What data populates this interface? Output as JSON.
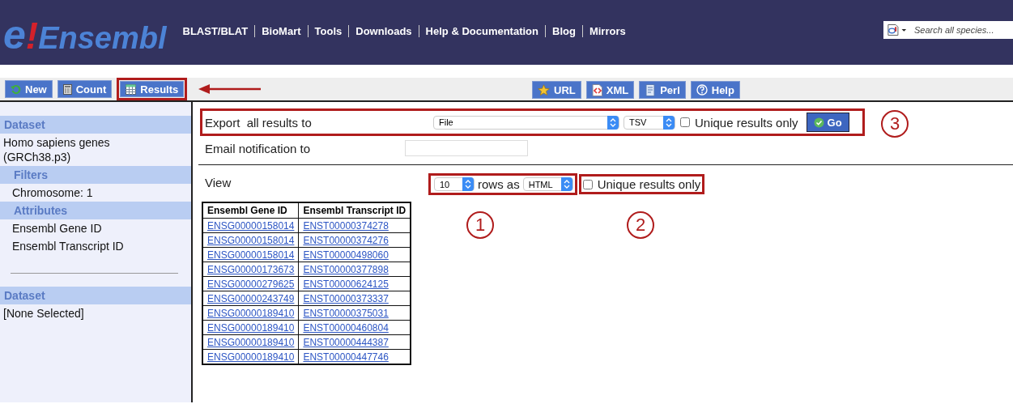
{
  "header": {
    "logo": [
      "e",
      "!",
      "Ensembl"
    ],
    "nav": [
      "BLAST/BLAT",
      "BioMart",
      "Tools",
      "Downloads",
      "Help & Documentation",
      "Blog",
      "Mirrors"
    ],
    "search": {
      "placeholder": "Search all species..."
    }
  },
  "toolbar": {
    "left": [
      {
        "label": "New",
        "highlighted": false
      },
      {
        "label": "Count",
        "highlighted": false
      },
      {
        "label": "Results",
        "highlighted": true
      }
    ],
    "right": [
      {
        "label": "URL"
      },
      {
        "label": "XML"
      },
      {
        "label": "Perl"
      },
      {
        "label": "Help"
      }
    ]
  },
  "sidebar": [
    {
      "kind": "header",
      "text": "Dataset"
    },
    {
      "kind": "text",
      "text": "Homo sapiens genes (GRCh38.p3)"
    },
    {
      "kind": "subheader",
      "text": "Filters"
    },
    {
      "kind": "item",
      "text": "Chromosome: 1"
    },
    {
      "kind": "subheader",
      "text": "Attributes"
    },
    {
      "kind": "item",
      "text": "Ensembl Gene ID"
    },
    {
      "kind": "item",
      "text": "Ensembl Transcript ID"
    },
    {
      "kind": "divider"
    },
    {
      "kind": "header",
      "text": "Dataset"
    },
    {
      "kind": "text",
      "text": "[None Selected]"
    }
  ],
  "export": {
    "label": "Export  all results to",
    "destination": "File",
    "format": "TSV",
    "unique_label": "Unique results only",
    "unique_checked": false,
    "go": "Go",
    "callout": "3"
  },
  "email": {
    "label": "Email notification to"
  },
  "view": {
    "label": "View",
    "rows": "10",
    "rows_as": "rows as",
    "format": "HTML",
    "rows_callout": "1",
    "unique_label": "Unique results only",
    "unique_checked": false,
    "unique_callout": "2"
  },
  "table": {
    "columns": [
      "Ensembl Gene ID",
      "Ensembl Transcript ID"
    ],
    "rows": [
      [
        "ENSG00000158014",
        "ENST00000374278"
      ],
      [
        "ENSG00000158014",
        "ENST00000374276"
      ],
      [
        "ENSG00000158014",
        "ENST00000498060"
      ],
      [
        "ENSG00000173673",
        "ENST00000377898"
      ],
      [
        "ENSG00000279625",
        "ENST00000624125"
      ],
      [
        "ENSG00000243749",
        "ENST00000373337"
      ],
      [
        "ENSG00000189410",
        "ENST00000375031"
      ],
      [
        "ENSG00000189410",
        "ENST00000460804"
      ],
      [
        "ENSG00000189410",
        "ENST00000444387"
      ],
      [
        "ENSG00000189410",
        "ENST00000447746"
      ]
    ]
  }
}
